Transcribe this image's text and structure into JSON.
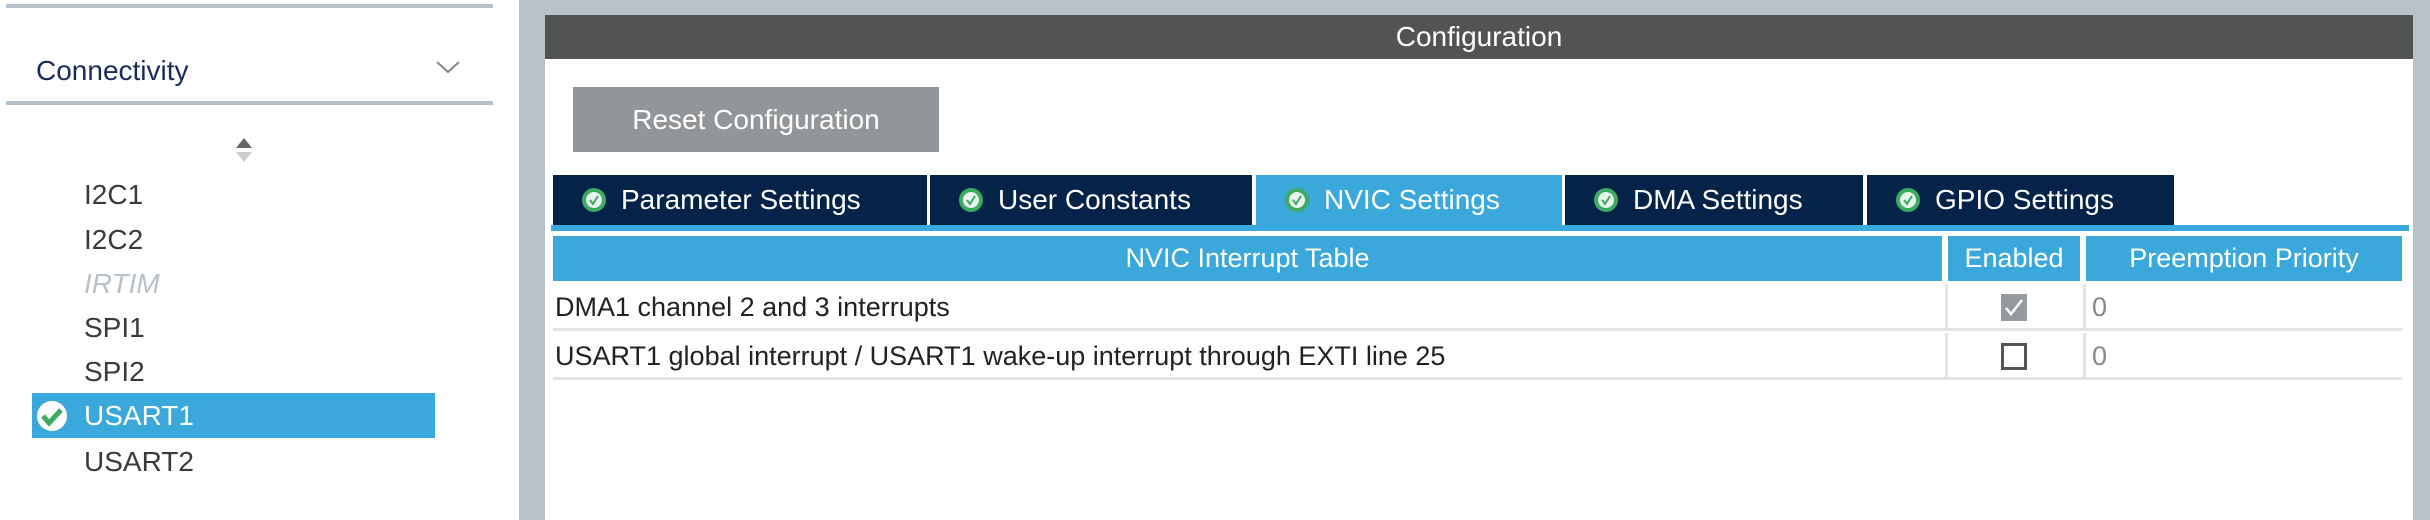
{
  "sidebar": {
    "category": "Connectivity",
    "items": [
      {
        "label": "I2C1",
        "state": "normal"
      },
      {
        "label": "I2C2",
        "state": "normal"
      },
      {
        "label": "IRTIM",
        "state": "disabled"
      },
      {
        "label": "SPI1",
        "state": "normal"
      },
      {
        "label": "SPI2",
        "state": "normal"
      },
      {
        "label": "USART1",
        "state": "selected",
        "configured": true
      },
      {
        "label": "USART2",
        "state": "normal"
      }
    ]
  },
  "config": {
    "title": "Configuration",
    "reset_label": "Reset Configuration",
    "tabs": [
      {
        "label": "Parameter Settings"
      },
      {
        "label": "User Constants"
      },
      {
        "label": "NVIC Settings",
        "active": true
      },
      {
        "label": "DMA Settings"
      },
      {
        "label": "GPIO Settings"
      }
    ],
    "table": {
      "headers": [
        "NVIC Interrupt Table",
        "Enabled",
        "Preemption Priority"
      ],
      "rows": [
        {
          "name": "DMA1 channel 2 and 3 interrupts",
          "enabled": true,
          "enabled_locked": true,
          "priority": "0"
        },
        {
          "name": "USART1 global interrupt / USART1 wake-up interrupt through EXTI line 25",
          "enabled": false,
          "priority": "0"
        }
      ]
    }
  },
  "colors": {
    "accent": "#3aa8da",
    "tab_dark": "#052249",
    "header": "#525453",
    "button": "#929699"
  }
}
